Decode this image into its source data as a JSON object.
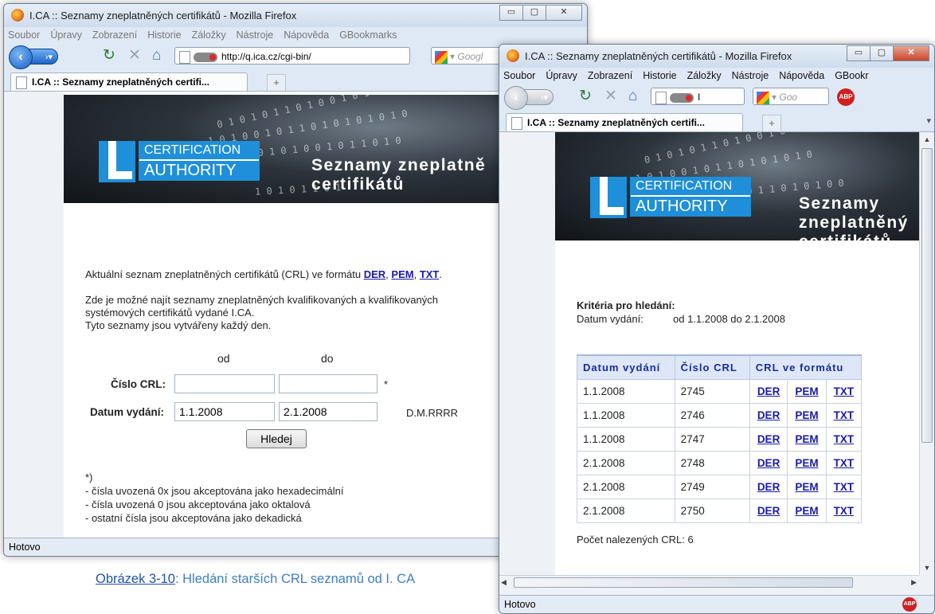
{
  "window1": {
    "title": "I.CA :: Seznamy zneplatněných certifikátů - Mozilla Firefox",
    "menu": [
      "Soubor",
      "Úpravy",
      "Zobrazení",
      "Historie",
      "Záložky",
      "Nástroje",
      "Nápověda",
      "GBookmarks"
    ],
    "url": "http://q.ica.cz/cgi-bin/",
    "google_placeholder": "Googl",
    "tab_title": "I.CA :: Seznamy zneplatněných certifi...",
    "logo_line1": "CERTIFICATION",
    "logo_line2": "AUTHORITY",
    "banner_title_line1": "Seznamy zneplatně",
    "banner_title_line2": "certifikátů",
    "crl_intro": "Aktuální seznam zneplatněných certifikátů (CRL) ve formátu ",
    "link_der": "DER",
    "link_pem": "PEM",
    "link_txt": "TXT",
    "sep1": ", ",
    "sep2": ", ",
    "end_dot": ".",
    "para2_line1": "Zde je možné najít seznamy zneplatněných kvalifikovaných a kvalifikovaných",
    "para2_line2": "systémových certifikátů vydané I.CA.",
    "para2_line3": "Tyto seznamy jsou vytvářeny každý den.",
    "col_od": "od",
    "col_do": "do",
    "label_cislo": "Číslo CRL:",
    "label_datum": "Datum vydání:",
    "cislo_od": "",
    "cislo_do": "",
    "star": "*",
    "datum_od": "1.1.2008",
    "datum_do": "2.1.2008",
    "date_format": "D.M.RRRR",
    "button_hledej": "Hledej",
    "note_star": "*)",
    "note1": "- čísla uvozená 0x jsou akceptována jako hexadecimální",
    "note2": "- čísla uvozená 0 jsou akceptována jako oktalová",
    "note3": "- ostatní čísla jsou akceptována jako dekadická",
    "status": "Hotovo"
  },
  "window2": {
    "title": "I.CA :: Seznamy zneplatněných certifikátů - Mozilla Firefox",
    "menu": [
      "Soubor",
      "Úpravy",
      "Zobrazení",
      "Historie",
      "Záložky",
      "Nástroje",
      "Nápověda",
      "GBookr"
    ],
    "url_fragment": "I",
    "google_placeholder": "Goo",
    "abp_label": "ABP",
    "tab_title": "I.CA :: Seznamy zneplatněných certifi...",
    "logo_line1": "CERTIFICATION",
    "logo_line2": "AUTHORITY",
    "banner_title_line1": "Seznamy",
    "banner_title_line2": "zneplatněný",
    "banner_title_line3": "certifikátů",
    "criteria_heading": "Kritéria pro hledání:",
    "criteria_label": "Datum vydání:",
    "criteria_value": "od 1.1.2008 do 2.1.2008",
    "table_headers": [
      "Datum vydání",
      "Číslo CRL",
      "CRL ve formátu"
    ],
    "rows": [
      {
        "date": "1.1.2008",
        "crl": "2745",
        "der": "DER",
        "pem": "PEM",
        "txt": "TXT"
      },
      {
        "date": "1.1.2008",
        "crl": "2746",
        "der": "DER",
        "pem": "PEM",
        "txt": "TXT"
      },
      {
        "date": "1.1.2008",
        "crl": "2747",
        "der": "DER",
        "pem": "PEM",
        "txt": "TXT"
      },
      {
        "date": "2.1.2008",
        "crl": "2748",
        "der": "DER",
        "pem": "PEM",
        "txt": "TXT"
      },
      {
        "date": "2.1.2008",
        "crl": "2749",
        "der": "DER",
        "pem": "PEM",
        "txt": "TXT"
      },
      {
        "date": "2.1.2008",
        "crl": "2750",
        "der": "DER",
        "pem": "PEM",
        "txt": "TXT"
      }
    ],
    "count_text": "Počet nalezených CRL: 6",
    "status": "Hotovo"
  },
  "caption": {
    "link": "Obrázek 3-10",
    "text": ": Hledání starších CRL seznamů od I. CA"
  }
}
